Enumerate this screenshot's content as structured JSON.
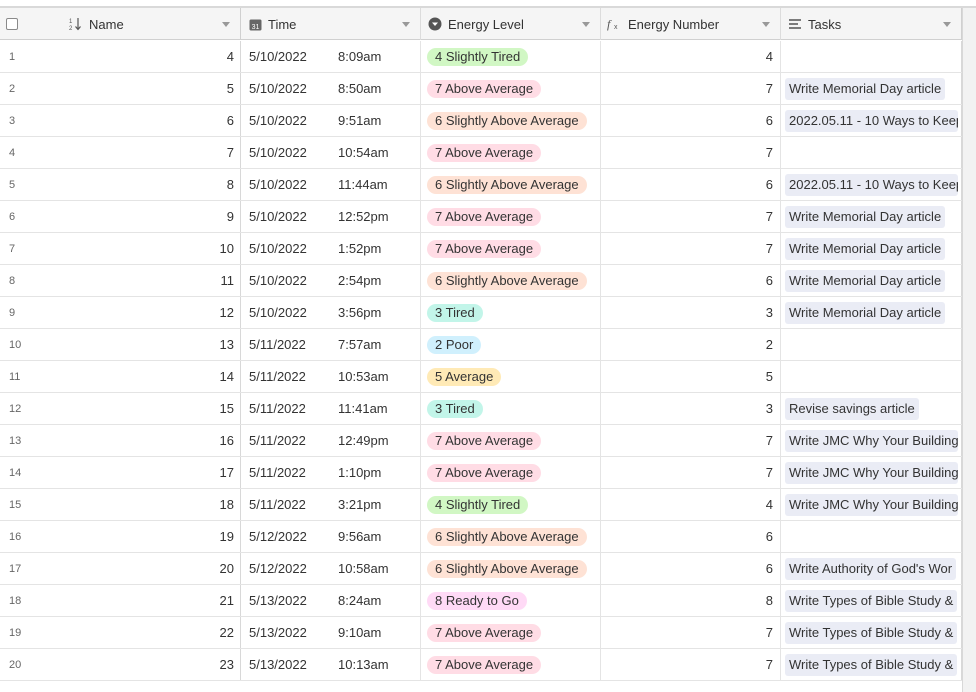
{
  "header": {
    "select_all": "",
    "columns": [
      {
        "label": "Name",
        "icon": "sort-numeric-icon"
      },
      {
        "label": "Time",
        "icon": "calendar-icon"
      },
      {
        "label": "Energy Level",
        "icon": "single-select-icon"
      },
      {
        "label": "Energy Number",
        "icon": "formula-icon"
      },
      {
        "label": "Tasks",
        "icon": "long-text-icon"
      }
    ]
  },
  "energy_colors": {
    "2 Poor": "#d0f0fd",
    "3 Tired": "#c2f5e9",
    "4 Slightly Tired": "#d1f7c4",
    "5 Average": "#ffeab6",
    "6 Slightly Above Average": "#fee2d5",
    "7 Above Average": "#ffdce5",
    "8 Ready to Go": "#ffdaf6"
  },
  "rows": [
    {
      "num": "1",
      "name": "4",
      "date": "5/10/2022",
      "time": "8:09am",
      "energy": "4 Slightly Tired",
      "energy_number": "4",
      "task": ""
    },
    {
      "num": "2",
      "name": "5",
      "date": "5/10/2022",
      "time": "8:50am",
      "energy": "7 Above Average",
      "energy_number": "7",
      "task": "Write Memorial Day article"
    },
    {
      "num": "3",
      "name": "6",
      "date": "5/10/2022",
      "time": "9:51am",
      "energy": "6 Slightly Above Average",
      "energy_number": "6",
      "task": "2022.05.11 - 10 Ways to Keep"
    },
    {
      "num": "4",
      "name": "7",
      "date": "5/10/2022",
      "time": "10:54am",
      "energy": "7 Above Average",
      "energy_number": "7",
      "task": ""
    },
    {
      "num": "5",
      "name": "8",
      "date": "5/10/2022",
      "time": "11:44am",
      "energy": "6 Slightly Above Average",
      "energy_number": "6",
      "task": "2022.05.11 - 10 Ways to Keep"
    },
    {
      "num": "6",
      "name": "9",
      "date": "5/10/2022",
      "time": "12:52pm",
      "energy": "7 Above Average",
      "energy_number": "7",
      "task": "Write Memorial Day article"
    },
    {
      "num": "7",
      "name": "10",
      "date": "5/10/2022",
      "time": "1:52pm",
      "energy": "7 Above Average",
      "energy_number": "7",
      "task": "Write Memorial Day article"
    },
    {
      "num": "8",
      "name": "11",
      "date": "5/10/2022",
      "time": "2:54pm",
      "energy": "6 Slightly Above Average",
      "energy_number": "6",
      "task": "Write Memorial Day article"
    },
    {
      "num": "9",
      "name": "12",
      "date": "5/10/2022",
      "time": "3:56pm",
      "energy": "3 Tired",
      "energy_number": "3",
      "task": "Write Memorial Day article"
    },
    {
      "num": "10",
      "name": "13",
      "date": "5/11/2022",
      "time": "7:57am",
      "energy": "2 Poor",
      "energy_number": "2",
      "task": ""
    },
    {
      "num": "11",
      "name": "14",
      "date": "5/11/2022",
      "time": "10:53am",
      "energy": "5 Average",
      "energy_number": "5",
      "task": ""
    },
    {
      "num": "12",
      "name": "15",
      "date": "5/11/2022",
      "time": "11:41am",
      "energy": "3 Tired",
      "energy_number": "3",
      "task": "Revise savings article"
    },
    {
      "num": "13",
      "name": "16",
      "date": "5/11/2022",
      "time": "12:49pm",
      "energy": "7 Above Average",
      "energy_number": "7",
      "task": "Write JMC Why Your Building"
    },
    {
      "num": "14",
      "name": "17",
      "date": "5/11/2022",
      "time": "1:10pm",
      "energy": "7 Above Average",
      "energy_number": "7",
      "task": "Write JMC Why Your Building"
    },
    {
      "num": "15",
      "name": "18",
      "date": "5/11/2022",
      "time": "3:21pm",
      "energy": "4 Slightly Tired",
      "energy_number": "4",
      "task": "Write JMC Why Your Building"
    },
    {
      "num": "16",
      "name": "19",
      "date": "5/12/2022",
      "time": "9:56am",
      "energy": "6 Slightly Above Average",
      "energy_number": "6",
      "task": ""
    },
    {
      "num": "17",
      "name": "20",
      "date": "5/12/2022",
      "time": "10:58am",
      "energy": "6 Slightly Above Average",
      "energy_number": "6",
      "task": "Write Authority of God's Wor"
    },
    {
      "num": "18",
      "name": "21",
      "date": "5/13/2022",
      "time": "8:24am",
      "energy": "8 Ready to Go",
      "energy_number": "8",
      "task": "Write Types of Bible Study &"
    },
    {
      "num": "19",
      "name": "22",
      "date": "5/13/2022",
      "time": "9:10am",
      "energy": "7 Above Average",
      "energy_number": "7",
      "task": "Write Types of Bible Study &"
    },
    {
      "num": "20",
      "name": "23",
      "date": "5/13/2022",
      "time": "10:13am",
      "energy": "7 Above Average",
      "energy_number": "7",
      "task": "Write Types of Bible Study &"
    }
  ]
}
